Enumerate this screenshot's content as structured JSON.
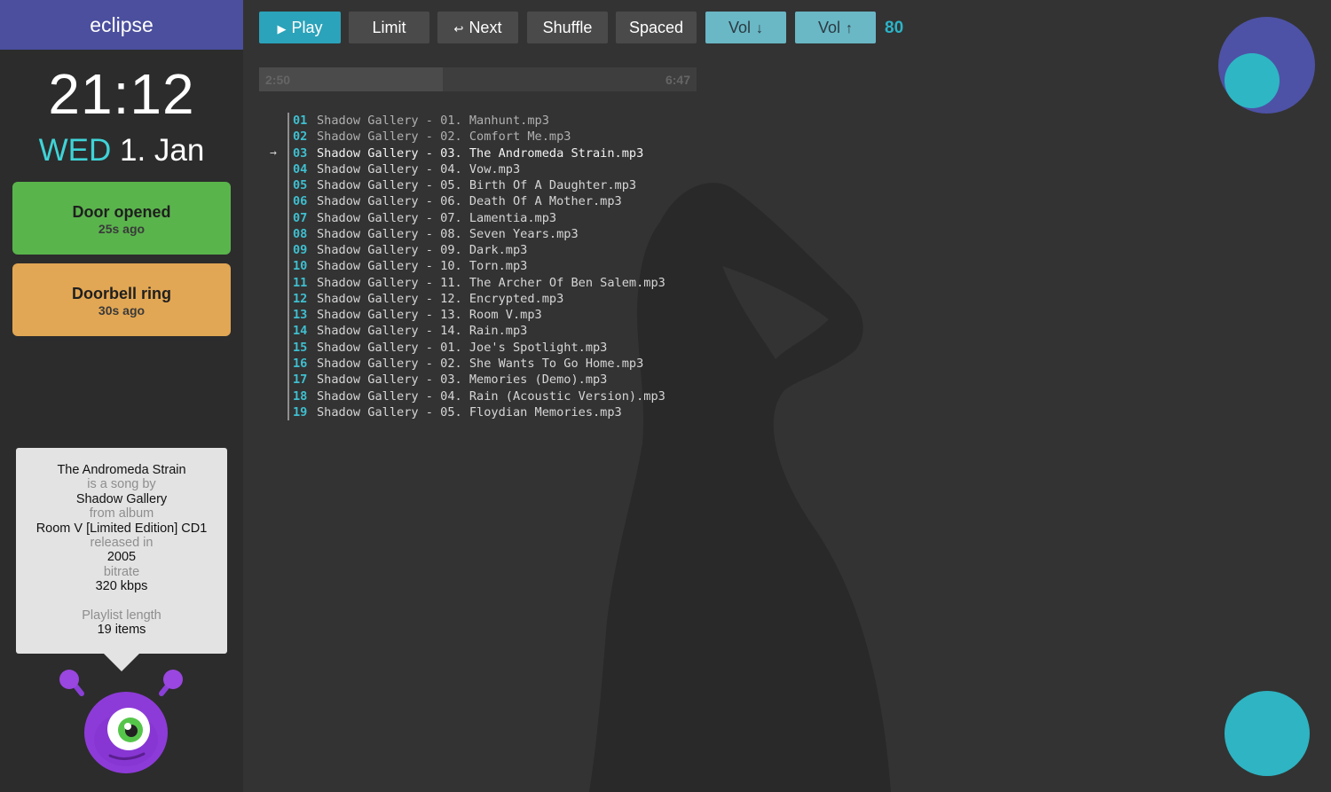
{
  "app": {
    "brand": "eclipse"
  },
  "clock": {
    "time": "21:12",
    "weekday": "WED",
    "date": "1. Jan"
  },
  "events": [
    {
      "title": "Door opened",
      "ago": "25s ago",
      "color": "#5ab44c"
    },
    {
      "title": "Doorbell ring",
      "ago": "30s ago",
      "color": "#e2a754"
    }
  ],
  "info": {
    "song": "The Andromeda Strain",
    "is_song_by_label": "is a song by",
    "artist": "Shadow Gallery",
    "from_album_label": "from album",
    "album": "Room V [Limited Edition] CD1",
    "released_label": "released in",
    "year": "2005",
    "bitrate_label": "bitrate",
    "bitrate": "320 kbps",
    "playlist_length_label": "Playlist length",
    "playlist_length": "19 items"
  },
  "toolbar": {
    "play": "Play",
    "limit": "Limit",
    "next": "Next",
    "shuffle": "Shuffle",
    "spaced": "Spaced",
    "vol_down": "Vol",
    "vol_up": "Vol",
    "volume": "80",
    "icons": {
      "play": "play-icon",
      "next": "undo-arrow-icon",
      "vol_down": "arrow-down-icon",
      "vol_up": "arrow-up-icon"
    }
  },
  "progress": {
    "elapsed": "2:50",
    "total": "6:47",
    "fraction": 0.42
  },
  "playlist": {
    "current_index": 2,
    "current_marker": "→",
    "tracks": [
      {
        "num": "01",
        "name": "Shadow Gallery - 01. Manhunt.mp3"
      },
      {
        "num": "02",
        "name": "Shadow Gallery - 02. Comfort Me.mp3"
      },
      {
        "num": "03",
        "name": "Shadow Gallery - 03. The Andromeda Strain.mp3"
      },
      {
        "num": "04",
        "name": "Shadow Gallery - 04. Vow.mp3"
      },
      {
        "num": "05",
        "name": "Shadow Gallery - 05. Birth Of A Daughter.mp3"
      },
      {
        "num": "06",
        "name": "Shadow Gallery - 06. Death Of A Mother.mp3"
      },
      {
        "num": "07",
        "name": "Shadow Gallery - 07. Lamentia.mp3"
      },
      {
        "num": "08",
        "name": "Shadow Gallery - 08. Seven Years.mp3"
      },
      {
        "num": "09",
        "name": "Shadow Gallery - 09. Dark.mp3"
      },
      {
        "num": "10",
        "name": "Shadow Gallery - 10. Torn.mp3"
      },
      {
        "num": "11",
        "name": "Shadow Gallery - 11. The Archer Of Ben Salem.mp3"
      },
      {
        "num": "12",
        "name": "Shadow Gallery - 12. Encrypted.mp3"
      },
      {
        "num": "13",
        "name": "Shadow Gallery - 13. Room V.mp3"
      },
      {
        "num": "14",
        "name": "Shadow Gallery - 14. Rain.mp3"
      },
      {
        "num": "15",
        "name": "Shadow Gallery - 01. Joe's Spotlight.mp3"
      },
      {
        "num": "16",
        "name": "Shadow Gallery - 02. She Wants To Go Home.mp3"
      },
      {
        "num": "17",
        "name": "Shadow Gallery - 03. Memories (Demo).mp3"
      },
      {
        "num": "18",
        "name": "Shadow Gallery - 04. Rain (Acoustic Version).mp3"
      },
      {
        "num": "19",
        "name": "Shadow Gallery - 05. Floydian Memories.mp3"
      }
    ]
  },
  "colors": {
    "accent": "#2ba3ba",
    "brand_bar": "#4b4f9d",
    "track_number": "#3fbfd0",
    "circle_purple": "#4d52a6",
    "circle_teal": "#2eb6c4"
  }
}
